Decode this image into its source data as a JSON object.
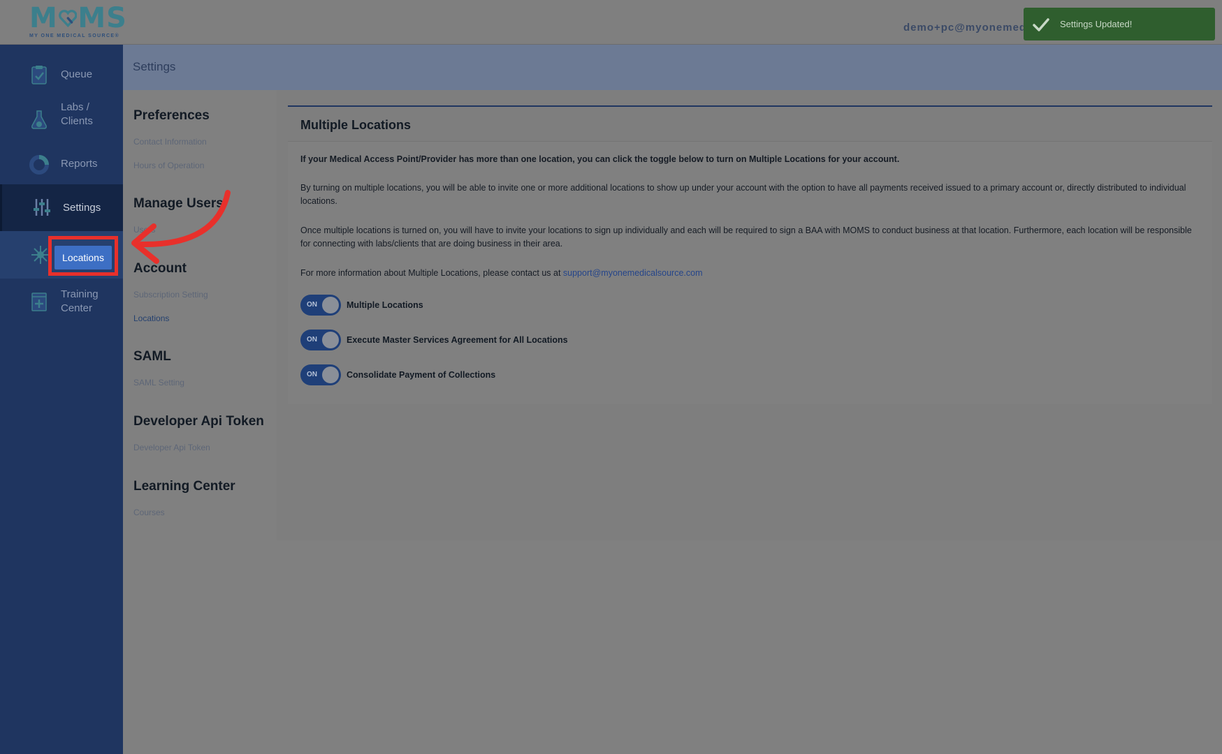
{
  "brand": {
    "logo_text": "MOMS",
    "logo_sub": "MY ONE MEDICAL SOURCE®",
    "color": "#3c7f8c"
  },
  "header": {
    "user_email": "demo+pc@myonemed"
  },
  "toast": {
    "message": "Settings Updated!",
    "color": "#2f5e2e"
  },
  "sidebar": {
    "items": [
      {
        "label": "Queue",
        "icon": "clipboard-check-icon"
      },
      {
        "label": "Labs /\nClients",
        "icon": "flask-icon"
      },
      {
        "label": "Reports",
        "icon": "donut-chart-icon"
      },
      {
        "label": "Settings",
        "icon": "sliders-icon"
      },
      {
        "label": "Locations",
        "icon": "network-icon"
      },
      {
        "label": "Training\nCenter",
        "icon": "book-plus-icon"
      }
    ]
  },
  "page": {
    "title": "Settings"
  },
  "settings_nav": {
    "sections": [
      {
        "heading": "Preferences",
        "links": [
          "Contact Information",
          "Hours of Operation"
        ]
      },
      {
        "heading": "Manage Users",
        "links": [
          "Users"
        ]
      },
      {
        "heading": "Account",
        "links": [
          "Subscription Setting",
          "Locations"
        ]
      },
      {
        "heading": "SAML",
        "links": [
          "SAML Setting"
        ]
      },
      {
        "heading": "Developer Api Token",
        "links": [
          "Developer Api Token"
        ]
      },
      {
        "heading": "Learning Center",
        "links": [
          "Courses"
        ]
      }
    ]
  },
  "card": {
    "title": "Multiple Locations",
    "intro": "If your Medical Access Point/Provider has more than one location, you can click the toggle below to turn on Multiple Locations for your account.",
    "p1": "By turning on multiple locations, you will be able to invite one or more additional locations to show up under your account with the option to have all payments received issued to a primary account or, directly distributed to individual locations.",
    "p2": "Once multiple locations is turned on, you will have to invite your locations to sign up individually and each will be required to sign a BAA with MOMS to conduct business at that location. Furthermore, each location will be responsible for connecting with labs/clients that are doing business in their area.",
    "contact_prefix": "For more information about Multiple Locations, please contact us at ",
    "contact_email": "support@myonemedicalsource.com",
    "toggles": [
      {
        "state": "ON",
        "label": "Multiple Locations"
      },
      {
        "state": "ON",
        "label": "Execute Master Services Agreement for All Locations"
      },
      {
        "state": "ON",
        "label": "Consolidate Payment of Collections"
      }
    ]
  },
  "annotation_color": "#e8302b"
}
